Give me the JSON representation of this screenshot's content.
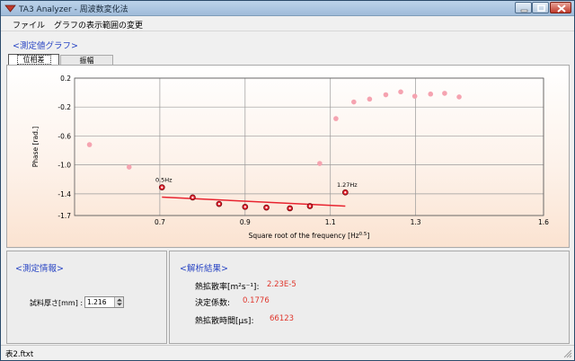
{
  "window": {
    "title": "TA3 Analyzer - 周波数変化法"
  },
  "menu": {
    "file": "ファイル",
    "graph_range": "グラフの表示範囲の変更"
  },
  "measured_group": {
    "label": "<測定値グラフ>"
  },
  "tabs": [
    {
      "label": "位相差"
    },
    {
      "label": "振幅"
    }
  ],
  "chart_data": {
    "type": "scatter",
    "xlabel": "Square root of the frequency [Hz",
    "xlabel_sup": "0.5",
    "xlabel_end": "]",
    "ylabel": "Phase [rad.]",
    "xlim": [
      0.5,
      1.6
    ],
    "ylim": [
      -1.7,
      0.2
    ],
    "x_ticks": [
      "0.7",
      "0.9",
      "1.1",
      "1.3",
      "1.6"
    ],
    "x_tick_values": [
      0.7,
      0.9,
      1.1,
      1.3,
      1.6
    ],
    "y_ticks": [
      "0.2",
      "-0.2",
      "-0.6",
      "-1.0",
      "-1.4",
      "-1.7"
    ],
    "y_tick_values": [
      0.2,
      -0.2,
      -0.6,
      -1.0,
      -1.4,
      -1.7
    ],
    "grid": true,
    "series": [
      {
        "role": "unselected",
        "color": "#f5a3b0",
        "points": [
          [
            0.535,
            -0.72
          ],
          [
            0.628,
            -1.03
          ],
          [
            1.075,
            -0.98
          ],
          [
            1.113,
            -0.36
          ],
          [
            1.155,
            -0.13
          ],
          [
            1.192,
            -0.09
          ],
          [
            1.23,
            -0.03
          ],
          [
            1.265,
            0.01
          ],
          [
            1.298,
            -0.05
          ],
          [
            1.335,
            -0.02
          ],
          [
            1.368,
            -0.01
          ],
          [
            1.402,
            -0.06
          ]
        ]
      },
      {
        "role": "fitted",
        "color": "#e8232f",
        "points": [
          [
            0.705,
            -1.31
          ],
          [
            0.777,
            -1.45
          ],
          [
            0.839,
            -1.54
          ],
          [
            0.9,
            -1.58
          ],
          [
            0.95,
            -1.59
          ],
          [
            1.005,
            -1.6
          ],
          [
            1.052,
            -1.57
          ],
          [
            1.135,
            -1.38
          ]
        ]
      }
    ],
    "fit_line": {
      "color": "#e8232f",
      "x": [
        0.705,
        1.135
      ],
      "y": [
        -1.445,
        -1.57
      ]
    },
    "annotations": [
      {
        "text": "0.5Hz",
        "x": 0.705,
        "y": -1.31
      },
      {
        "text": "1.27Hz",
        "x": 1.135,
        "y": -1.38
      }
    ],
    "colors": {
      "grid": "#9a9a9a",
      "axis": "#555555"
    }
  },
  "info_group": {
    "label": "<測定情報>",
    "thickness_label": "試料厚さ[mm] :",
    "thickness_value": "1.216"
  },
  "results_group": {
    "label": "<解析結果>",
    "rows": [
      {
        "label": "熱拡散率[m²s⁻¹]:",
        "value": "2.23E-5"
      },
      {
        "label": "決定係数:",
        "value": "0.1776"
      },
      {
        "label": "熱拡散時間[μs]:",
        "value": "66123"
      }
    ]
  },
  "status": {
    "file": "表2.ftxt"
  }
}
